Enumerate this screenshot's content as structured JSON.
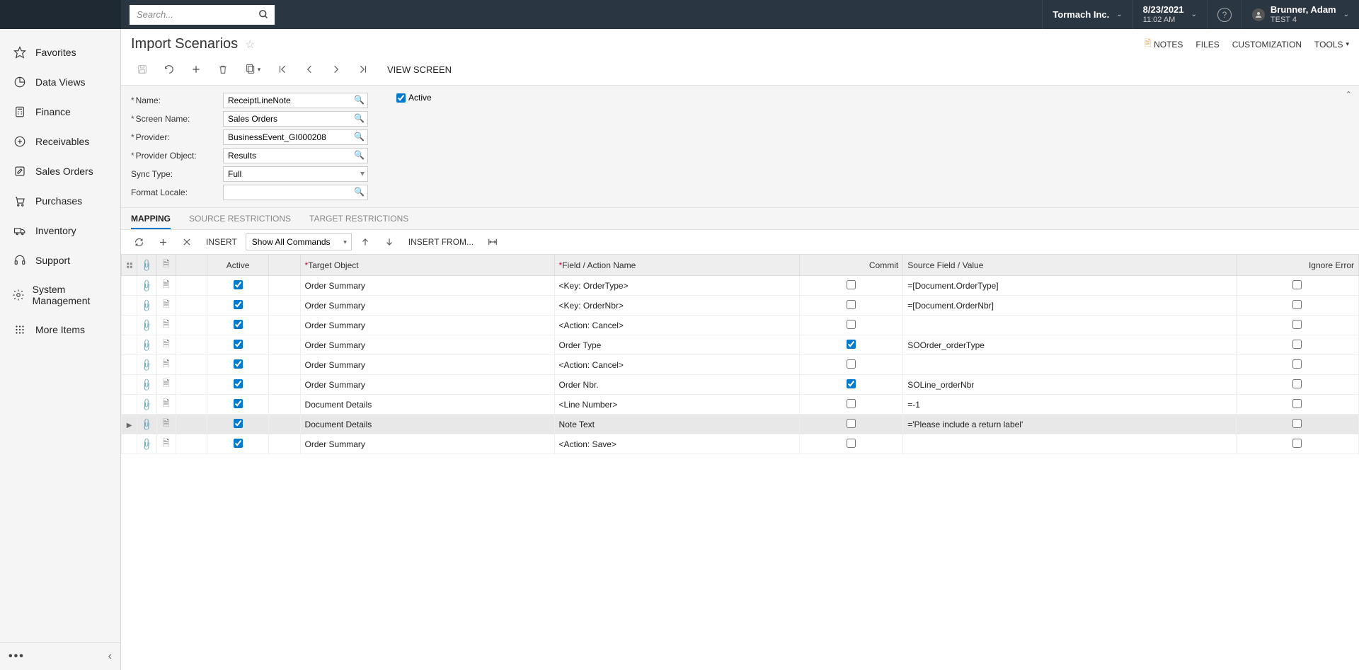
{
  "search": {
    "placeholder": "Search..."
  },
  "header": {
    "company": "Tormach Inc.",
    "date": "8/23/2021",
    "time": "11:02 AM",
    "user_name": "Brunner, Adam",
    "user_env": "TEST 4"
  },
  "sidebar": {
    "items": [
      {
        "label": "Favorites"
      },
      {
        "label": "Data Views"
      },
      {
        "label": "Finance"
      },
      {
        "label": "Receivables"
      },
      {
        "label": "Sales Orders"
      },
      {
        "label": "Purchases"
      },
      {
        "label": "Inventory"
      },
      {
        "label": "Support"
      },
      {
        "label": "System Management"
      },
      {
        "label": "More Items"
      }
    ]
  },
  "page": {
    "title": "Import Scenarios",
    "buttons": {
      "notes": "NOTES",
      "files": "FILES",
      "customization": "CUSTOMIZATION",
      "tools": "TOOLS"
    },
    "view_screen": "VIEW SCREEN"
  },
  "form": {
    "labels": {
      "name": "Name:",
      "screen_name": "Screen Name:",
      "provider": "Provider:",
      "provider_object": "Provider Object:",
      "sync_type": "Sync Type:",
      "format_locale": "Format Locale:",
      "active": "Active"
    },
    "values": {
      "name": "ReceiptLineNote",
      "screen_name": "Sales Orders",
      "provider": "BusinessEvent_GI000208",
      "provider_object": "Results",
      "sync_type": "Full",
      "format_locale": ""
    },
    "active_checked": true
  },
  "tabs": {
    "mapping": "MAPPING",
    "source_restrictions": "SOURCE RESTRICTIONS",
    "target_restrictions": "TARGET RESTRICTIONS"
  },
  "grid_toolbar": {
    "insert": "INSERT",
    "show_all": "Show All Commands",
    "insert_from": "INSERT FROM..."
  },
  "grid": {
    "headers": {
      "active": "Active",
      "target": "Target Object",
      "field": "Field / Action Name",
      "commit": "Commit",
      "source": "Source Field / Value",
      "ignore": "Ignore Error"
    },
    "rows": [
      {
        "active": true,
        "target": "Order Summary",
        "field": "<Key: OrderType>",
        "commit": false,
        "source": "=[Document.OrderType]",
        "ignore": false,
        "selected": false
      },
      {
        "active": true,
        "target": "Order Summary",
        "field": "<Key: OrderNbr>",
        "commit": false,
        "source": "=[Document.OrderNbr]",
        "ignore": false,
        "selected": false
      },
      {
        "active": true,
        "target": "Order Summary",
        "field": "<Action: Cancel>",
        "commit": false,
        "source": "",
        "ignore": false,
        "selected": false
      },
      {
        "active": true,
        "target": "Order Summary",
        "field": "Order Type",
        "commit": true,
        "source": "SOOrder_orderType",
        "ignore": false,
        "selected": false
      },
      {
        "active": true,
        "target": "Order Summary",
        "field": "<Action: Cancel>",
        "commit": false,
        "source": "",
        "ignore": false,
        "selected": false
      },
      {
        "active": true,
        "target": "Order Summary",
        "field": "Order Nbr.",
        "commit": true,
        "source": "SOLine_orderNbr",
        "ignore": false,
        "selected": false
      },
      {
        "active": true,
        "target": "Document Details",
        "field": "<Line Number>",
        "commit": false,
        "source": "=-1",
        "ignore": false,
        "selected": false
      },
      {
        "active": true,
        "target": "Document Details",
        "field": "Note Text",
        "commit": false,
        "source": "='Please include a return label'",
        "ignore": false,
        "selected": true
      },
      {
        "active": true,
        "target": "Order Summary",
        "field": "<Action: Save>",
        "commit": false,
        "source": "",
        "ignore": false,
        "selected": false
      }
    ]
  }
}
